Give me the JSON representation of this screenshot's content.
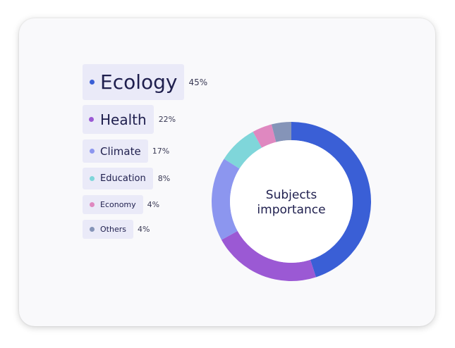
{
  "chart_data": {
    "type": "pie",
    "variant": "donut",
    "center_label_line1": "Subjects",
    "center_label_line2": "importance",
    "categories": [
      "Ecology",
      "Health",
      "Climate",
      "Education",
      "Economy",
      "Others"
    ],
    "values": [
      45,
      22,
      17,
      8,
      4,
      4
    ],
    "value_labels": [
      "45%",
      "22%",
      "17%",
      "8%",
      "4%",
      "4%"
    ],
    "colors": [
      "#3a5fd6",
      "#9b59d4",
      "#8c96ef",
      "#7fd6da",
      "#df88c0",
      "#8594b8"
    ],
    "legend_position": "left"
  }
}
